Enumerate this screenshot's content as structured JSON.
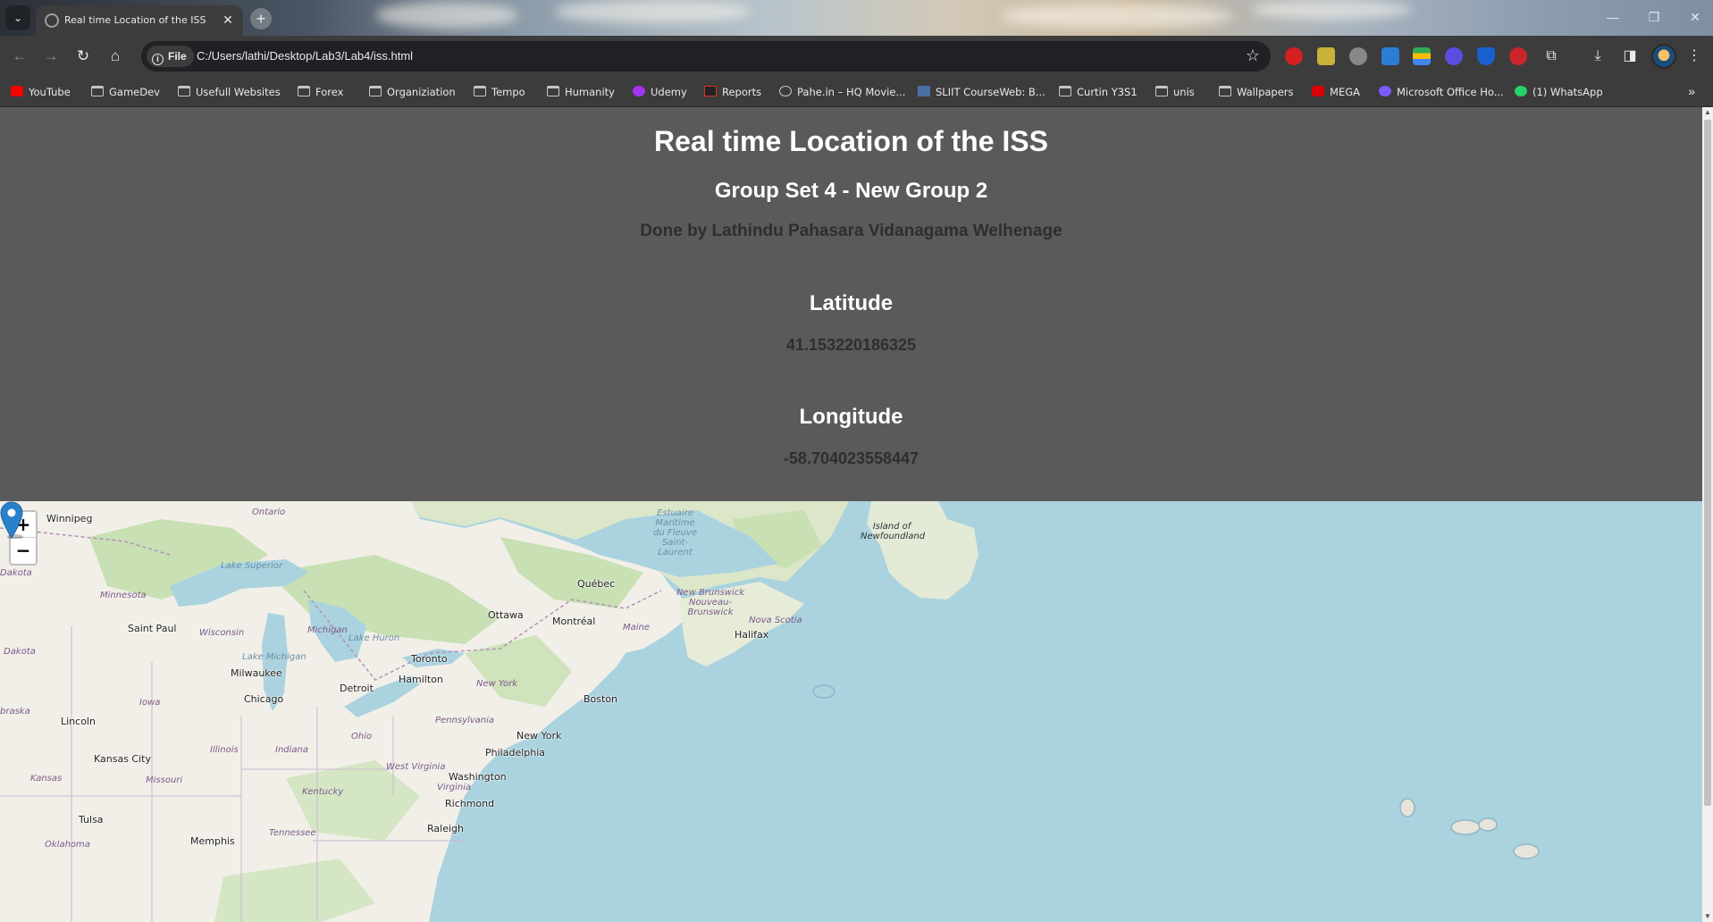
{
  "browser": {
    "tab_title": "Real time Location of the ISS",
    "new_tab": "+",
    "close_tab": "✕",
    "site_info": "File",
    "url": "C:/Users/lathi/Desktop/Lab3/Lab4/iss.html"
  },
  "bookmarks": [
    {
      "label": "YouTube",
      "icon": "youtube-icon",
      "color": "#ff0000"
    },
    {
      "label": "GameDev",
      "icon": "folder-icon"
    },
    {
      "label": "Usefull Websites",
      "icon": "folder-icon"
    },
    {
      "label": "Forex",
      "icon": "folder-icon"
    },
    {
      "label": "Organiziation",
      "icon": "folder-icon"
    },
    {
      "label": "Tempo",
      "icon": "folder-icon"
    },
    {
      "label": "Humanity",
      "icon": "folder-icon"
    },
    {
      "label": "Udemy",
      "icon": "udemy-icon",
      "color": "#a435f0"
    },
    {
      "label": "Reports",
      "icon": "reports-icon",
      "color": "#d93025"
    },
    {
      "label": "Pahe.in – HQ Movie...",
      "icon": "globe-icon"
    },
    {
      "label": "SLIIT CourseWeb: B...",
      "icon": "sliit-icon",
      "color": "#4a6fa5"
    },
    {
      "label": "Curtin Y3S1",
      "icon": "folder-icon"
    },
    {
      "label": "unis",
      "icon": "folder-icon"
    },
    {
      "label": "Wallpapers",
      "icon": "folder-icon"
    },
    {
      "label": "MEGA",
      "icon": "mega-icon",
      "color": "#d90007"
    },
    {
      "label": "Microsoft Office Ho...",
      "icon": "office-icon",
      "color": "#7a5cff"
    },
    {
      "label": "(1) WhatsApp",
      "icon": "whatsapp-icon",
      "color": "#25d366"
    }
  ],
  "page": {
    "title": "Real time Location of the ISS",
    "subtitle": "Group Set 4 - New Group 2",
    "author": "Done by Lathindu Pahasara Vidanagama Welhenage",
    "latitude_label": "Latitude",
    "latitude_value": "41.153220186325",
    "longitude_label": "Longitude",
    "longitude_value": "-58.704023558447"
  },
  "map": {
    "zoom_in": "+",
    "zoom_out": "−",
    "cities": [
      "Winnipeg",
      "Québec",
      "Ottawa",
      "Montréal",
      "Halifax",
      "Saint Paul",
      "Toronto",
      "Hamilton",
      "Milwaukee",
      "Detroit",
      "Chicago",
      "Boston",
      "Lincoln",
      "New York",
      "Philadelphia",
      "Kansas City",
      "Washington",
      "Richmond",
      "Tulsa",
      "Raleigh",
      "Memphis"
    ],
    "regions": [
      "Ontario",
      "Minnesota",
      "Wisconsin",
      "Michigan",
      "Iowa",
      "Illinois",
      "Indiana",
      "Ohio",
      "Pennsylvania",
      "New York",
      "West Virginia",
      "Virginia",
      "Kentucky",
      "Tennessee",
      "Missouri",
      "Kansas",
      "Dakota",
      "Dakota",
      "braska",
      "Maine",
      "Nova Scotia",
      "New Brunswick Nouveau-Brunswick",
      "Oklahoma"
    ],
    "water": [
      "Lake Superior",
      "Lake Michigan",
      "Lake Huron",
      "Estuaire Maritime du Fleuve Saint-Laurent",
      "Island of Newfoundland"
    ],
    "marker": "location-marker",
    "colors": {
      "water": "#aad3df",
      "land": "#f2efe9",
      "forest": "#c8e0b4"
    }
  }
}
